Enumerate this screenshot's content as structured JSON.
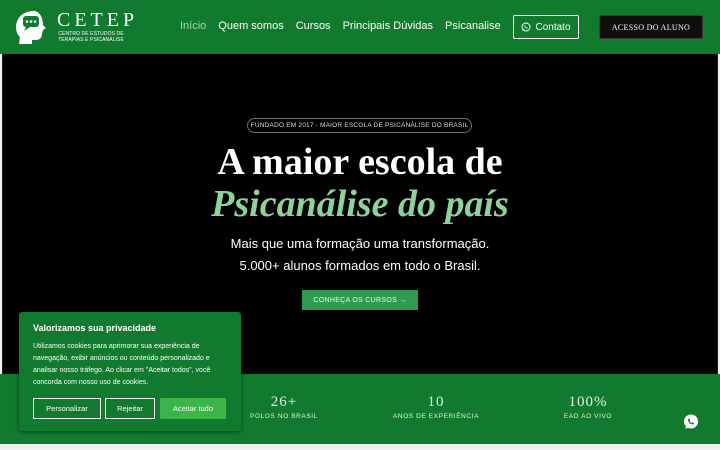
{
  "nav": {
    "brand": "CETEP",
    "brand_sub": "CENTRO DE ESTUDOS DE TERAPIAS E PSICANÁLISE",
    "items": [
      {
        "label": "Início",
        "active": true
      },
      {
        "label": "Quem somos"
      },
      {
        "label": "Cursos"
      },
      {
        "label": "Principais Dúvidas"
      },
      {
        "label": "Psicanalise"
      }
    ],
    "contact_label": "Contato",
    "access_label": "ACESSO DO ALUNO"
  },
  "hero": {
    "badge": "FUNDADO EM 2017 · MAIOR ESCOLA DE PSICANÁLISE DO BRASIL",
    "title": "A maior escola de",
    "title_highlight": "Psicanálise do país",
    "lead_1": "Mais que uma formação  uma transformação.",
    "lead_2": "5.000+ alunos formados em todo o Brasil.",
    "cta": "CONHEÇA OS CURSOS →"
  },
  "stats": [
    {
      "value": "26+",
      "label": "POLOS NO BRASIL"
    },
    {
      "value": "10",
      "label": "ANOS DE EXPERIÊNCIA"
    },
    {
      "value": "100%",
      "label": "EAD AO VIVO"
    }
  ],
  "cookie": {
    "title": "Valorizamos sua privacidade",
    "body": "Utilizamos cookies para aprimorar sua experiência de navegação, exibir anúncios ou conteúdo personalizado e analisar nosso tráfego. Ao clicar em \"Aceitar todos\", você concorda com nosso uso de cookies.",
    "customize": "Personalizar",
    "reject": "Rejeitar",
    "accept": "Aceitar tudo"
  },
  "colors": {
    "brand_green": "#117a2f",
    "accent_green": "#8fd19b",
    "cta_green": "#2f9a51",
    "accept_green": "#39b54a"
  },
  "icons": {
    "logo": "head-chat-icon",
    "contact": "whatsapp-icon",
    "chat": "chat-bubble-icon"
  }
}
